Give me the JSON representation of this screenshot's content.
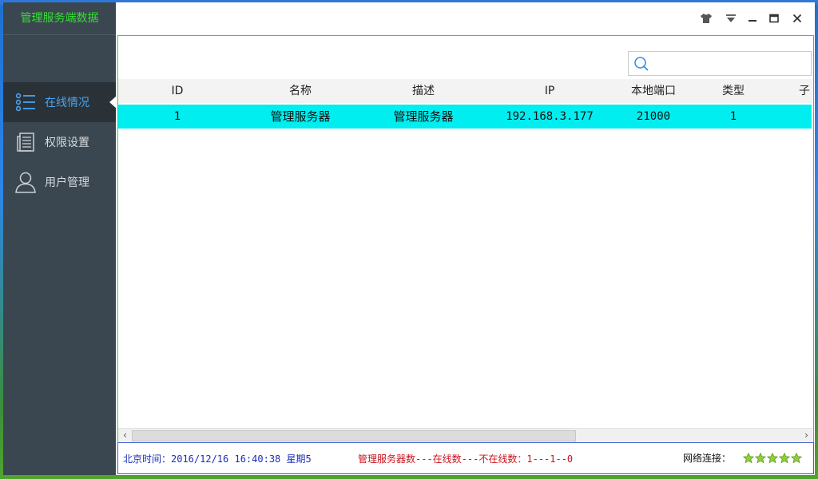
{
  "app": {
    "title": "管理服务端数据"
  },
  "sidebar": {
    "items": [
      {
        "label": "在线情况",
        "icon": "list-icon",
        "active": true
      },
      {
        "label": "权限设置",
        "icon": "document-icon",
        "active": false
      },
      {
        "label": "用户管理",
        "icon": "user-icon",
        "active": false
      }
    ]
  },
  "titlebar": {
    "buttons": [
      "skin-icon",
      "menu-dropdown-icon",
      "minimize-icon",
      "maximize-icon",
      "close-icon"
    ]
  },
  "search": {
    "value": "",
    "placeholder": ""
  },
  "table": {
    "columns": [
      "ID",
      "名称",
      "描述",
      "IP",
      "本地端口",
      "类型",
      "子"
    ],
    "rows": [
      {
        "id": "1",
        "name": "管理服务器",
        "desc": "管理服务器",
        "ip": "192.168.3.177",
        "port": "21000",
        "type": "1"
      }
    ],
    "selected_row_color": "#00eef0"
  },
  "status": {
    "time": "北京时间：2016/12/16 16:40:38 星期5",
    "counts": "管理服务器数---在线数---不在线数：1---1--0",
    "network_label": "网络连接：",
    "network_stars": 5
  },
  "colors": {
    "accent": "#4aa3f0",
    "title_green": "#32e032",
    "sidebar_bg": "#3b4750",
    "border_green": "#3fcc3f"
  }
}
